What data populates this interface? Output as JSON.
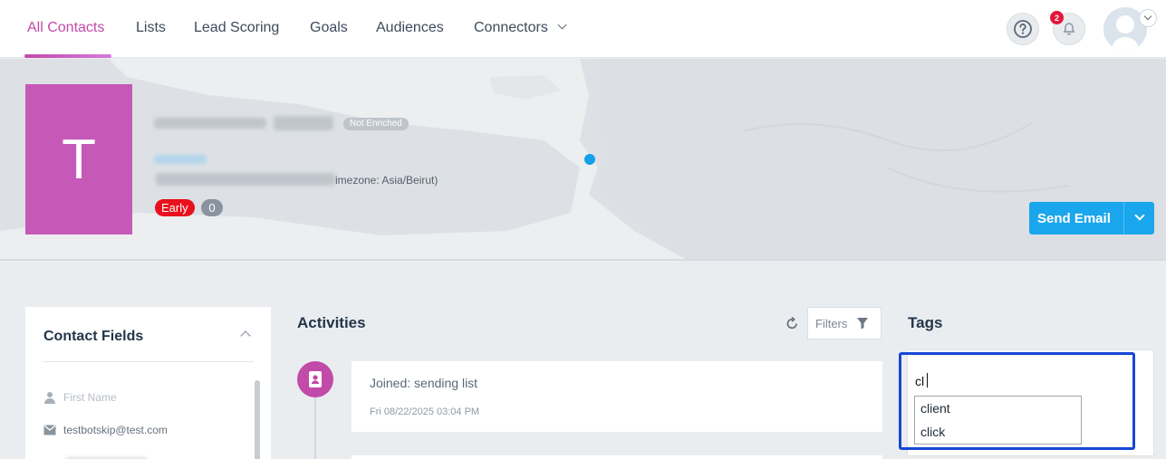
{
  "nav": {
    "tabs": [
      {
        "label": "All Contacts",
        "active": true
      },
      {
        "label": "Lists"
      },
      {
        "label": "Lead Scoring"
      },
      {
        "label": "Goals"
      },
      {
        "label": "Audiences"
      },
      {
        "label": "Connectors"
      }
    ],
    "help_icon": "question-circle-icon",
    "notification_icon": "bell-icon",
    "notification_count": "2",
    "avatar_icon": "user-avatar-icon"
  },
  "contact": {
    "initial": "T",
    "enrichment_badge": "Not Enriched",
    "timezone_text": "imezone: Asia/Beirut)",
    "lifecycle_badge": "Early",
    "score_badge": "0",
    "send_email_label": "Send Email"
  },
  "contact_fields": {
    "title": "Contact Fields",
    "rows": [
      {
        "icon": "person-icon",
        "value": "First Name"
      },
      {
        "icon": "envelope-icon",
        "value": "testbotskip@test.com"
      }
    ]
  },
  "activities": {
    "title": "Activities",
    "filters_label": "Filters",
    "items": [
      {
        "text": "Joined: sending list",
        "date": "Fri 08/22/2025 03:04 PM"
      }
    ]
  },
  "tags": {
    "title": "Tags",
    "input_value": "cl",
    "suggestions": [
      "client",
      "click"
    ]
  },
  "colors": {
    "accent": "#c24aa8",
    "primary_button": "#1aa6ec",
    "badge_red": "#e8101c",
    "highlight_border": "#1746d6"
  }
}
